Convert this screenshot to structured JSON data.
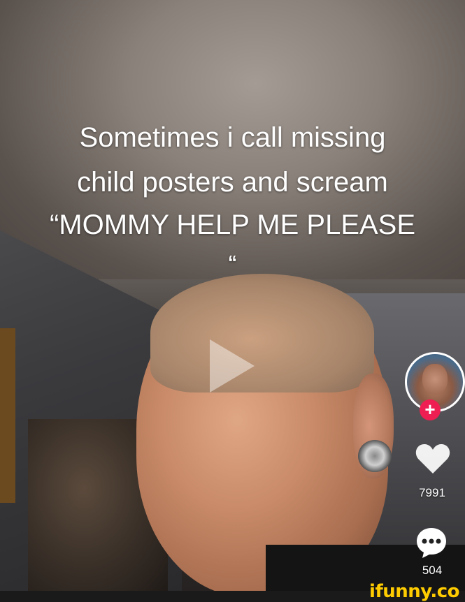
{
  "caption": {
    "line1": "Sometimes i call missing",
    "line2": "child posters and scream",
    "line3": "“MOMMY HELP ME PLEASE",
    "line4": "“"
  },
  "sidebar": {
    "follow_symbol": "+",
    "likes_count": "7991",
    "comments_count": "504",
    "comment_dots": "•••"
  },
  "watermark": {
    "text": "ifunny.co",
    "color": "#ffcc00"
  },
  "colors": {
    "follow_button": "#ee1d52",
    "icons": "#ffffff"
  },
  "icons": {
    "play": "play-icon",
    "heart": "heart-icon",
    "comment": "comment-icon"
  }
}
